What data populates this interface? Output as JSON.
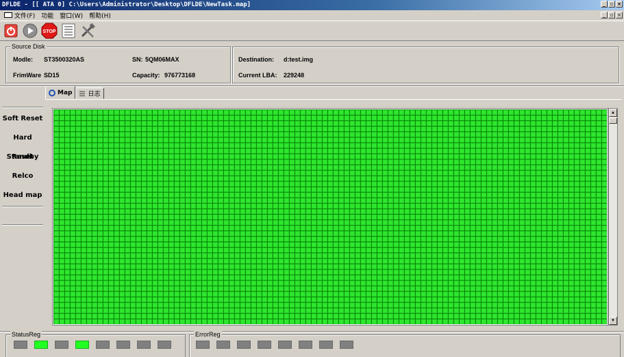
{
  "window": {
    "title": "DFLDE - [[ ATA 0]  C:\\Users\\Administrator\\Desktop\\DFLDE\\NewTask.map]",
    "controls": [
      "_",
      "8",
      "X"
    ]
  },
  "menu": {
    "items": [
      "文件(F)",
      "功能",
      "窗口(W)",
      "帮助(H)"
    ],
    "controls": [
      "_",
      "8",
      "X"
    ]
  },
  "toolbar": {
    "tools": [
      "power-icon",
      "play-icon",
      "stop-icon",
      "hex-view-icon",
      "tools-icon"
    ],
    "stop_label": "STOP"
  },
  "source": {
    "legend": "Source Disk",
    "model_label": "Modle:",
    "model_value": "ST3500320AS",
    "sn_label": "SN:",
    "sn_value": "5QM06MAX",
    "firmware_label": "FrimWare",
    "firmware_value": "SD15",
    "capacity_label": "Capacity:",
    "capacity_value": "976773168"
  },
  "destination": {
    "dest_label": "Destination:",
    "dest_value": "d:test.img",
    "lba_label": "Current LBA:",
    "lba_value": "229248"
  },
  "commands": [
    "Soft Reset",
    "Hard Reset",
    "Standby",
    "Relco",
    "Head map"
  ],
  "tabs": {
    "map": "Map",
    "log": "日志"
  },
  "map": {
    "cell_color": "#2ee62e",
    "cell_border": "#0a8a0a",
    "columns": 101,
    "rows": 39
  },
  "status_reg": {
    "label": "StatusReg",
    "leds": [
      false,
      true,
      false,
      true,
      false,
      false,
      false,
      false
    ]
  },
  "error_reg": {
    "label": "ErrorReg",
    "leds": [
      false,
      false,
      false,
      false,
      false,
      false,
      false,
      false
    ]
  }
}
